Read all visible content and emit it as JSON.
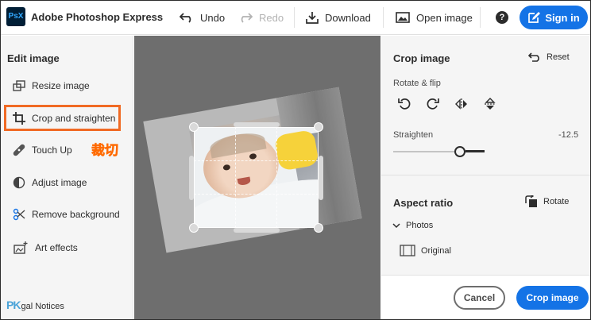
{
  "app": {
    "logo_text": "PsX",
    "title": "Adobe Photoshop Express"
  },
  "toolbar": {
    "undo_label": "Undo",
    "redo_label": "Redo",
    "download_label": "Download",
    "open_image_label": "Open image",
    "help_glyph": "?",
    "sign_in_label": "Sign in",
    "accent_color": "#1473e6"
  },
  "sidebar": {
    "title": "Edit image",
    "items": [
      {
        "label": "Resize image",
        "icon": "resize-icon"
      },
      {
        "label": "Crop and straighten",
        "icon": "crop-icon",
        "active": true
      },
      {
        "label": "Touch Up",
        "icon": "bandage-icon"
      },
      {
        "label": "Adjust image",
        "icon": "adjust-icon"
      },
      {
        "label": "Remove background",
        "icon": "remove-background-icon"
      },
      {
        "label": "Art effects",
        "icon": "art-effects-icon"
      }
    ],
    "annotation": "裁切",
    "watermark": "PK",
    "legal_label": "gal Notices",
    "highlight_color": "#f06a24"
  },
  "panel": {
    "crop_title": "Crop image",
    "reset_label": "Reset",
    "rotate_flip_label": "Rotate & flip",
    "rotate_flip_tools": [
      "rotate-left-icon",
      "rotate-right-icon",
      "flip-horizontal-icon",
      "flip-vertical-icon"
    ],
    "straighten_label": "Straighten",
    "straighten_value": "-12.5",
    "aspect_title": "Aspect ratio",
    "rotate_label": "Rotate",
    "photos_label": "Photos",
    "original_label": "Original",
    "cancel_label": "Cancel",
    "crop_button_label": "Crop image"
  }
}
